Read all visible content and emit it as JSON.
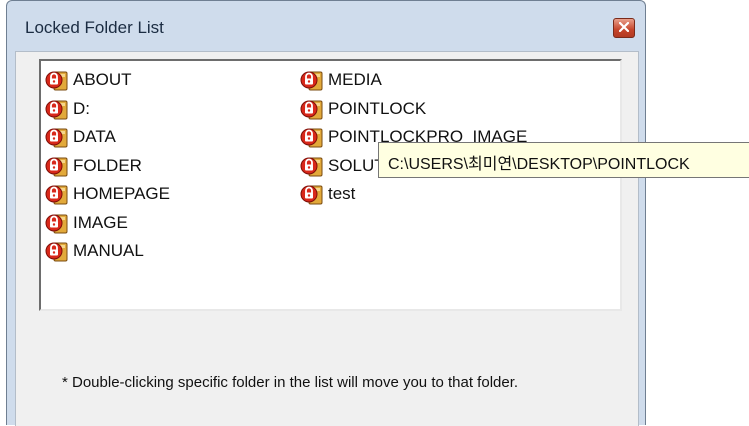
{
  "window": {
    "title": "Locked Folder List",
    "close_label": "x"
  },
  "list": {
    "left_column": [
      "ABOUT",
      "D:",
      "DATA",
      "FOLDER",
      "HOMEPAGE",
      "IMAGE",
      "MANUAL"
    ],
    "right_column": [
      "MEDIA",
      "POINTLOCK",
      "POINTLOCKPRO_IMAGE",
      "SOLUTION",
      "test"
    ],
    "item_icon": "locked-folder-icon"
  },
  "tooltip": {
    "text": "C:\\USERS\\최미연\\DESKTOP\\POINTLOCK"
  },
  "note": "* Double-clicking specific folder in the list will move you to that folder.",
  "colors": {
    "icon_red": "#d8281a",
    "icon_gold": "#e2a93a",
    "tooltip_bg": "#ffffe1",
    "frame": "#cfdcec",
    "close_red": "#c5442a"
  }
}
